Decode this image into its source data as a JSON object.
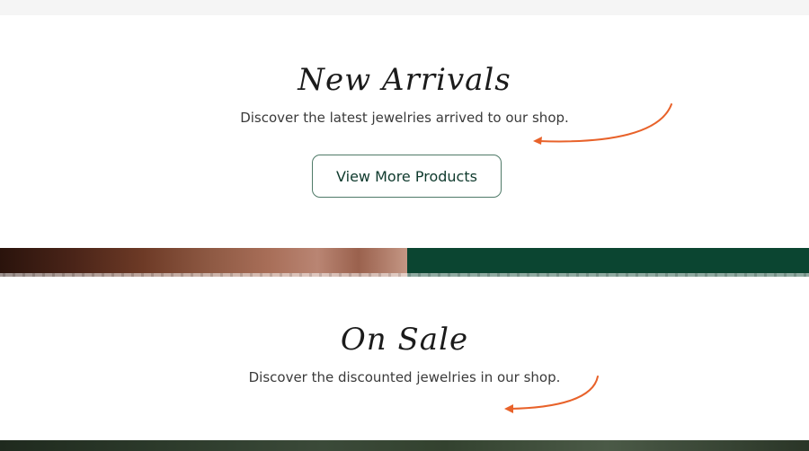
{
  "new_arrivals": {
    "title": "New Arrivals",
    "subtitle": "Discover the latest jewelries arrived to our shop.",
    "button_label": "View More Products"
  },
  "on_sale": {
    "title": "On Sale",
    "subtitle": "Discover the discounted jewelries in our shop."
  },
  "colors": {
    "accent_arrow": "#e8622a",
    "brand_green": "#0b4531",
    "button_border": "#4f7a68"
  },
  "icons": {
    "arrow": "curved-arrow-icon"
  }
}
